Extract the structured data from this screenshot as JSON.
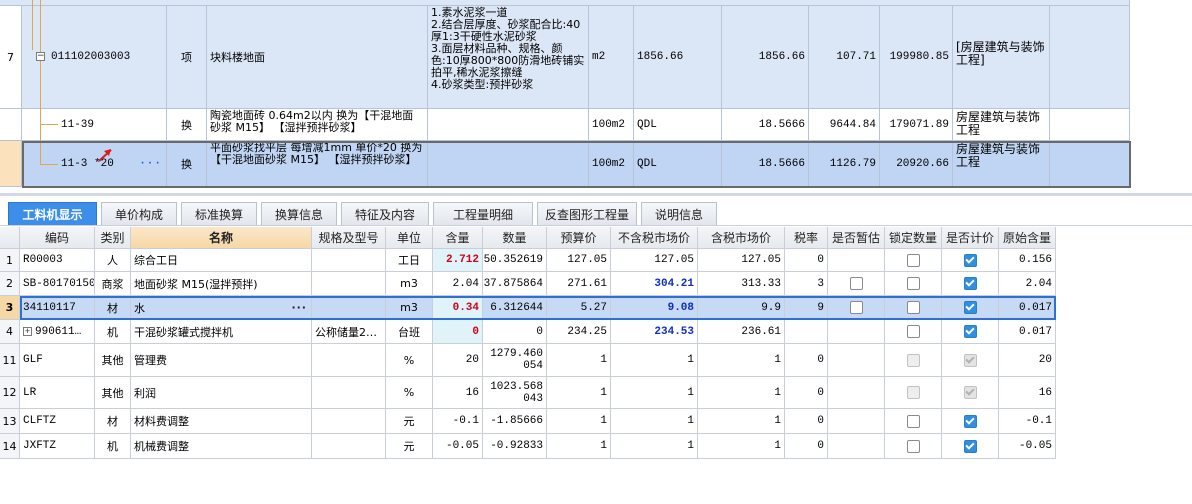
{
  "upper_grid": {
    "rows": [
      {
        "row_no": "7",
        "code": "011102003003",
        "type": "项",
        "name": "块料楼地面",
        "features": "1.素水泥浆一道\n2.结合层厚度、砂浆配合比:40厚1:3干硬性水泥砂浆\n3.面层材料品种、规格、颜色:10厚800*800防滑地砖铺实拍平,稀水泥浆擦缝\n4.砂浆类型:预拌砂浆",
        "unit": "m2",
        "expr": "1856.66",
        "qty": "1856.66",
        "price": "107.71",
        "total": "199980.85",
        "specialty": "[房屋建筑与装饰工程]"
      },
      {
        "row_no": "",
        "code": "11-39",
        "type": "换",
        "name": "陶瓷地面砖 0.64m2以内  换为【干混地面砂浆 M15】 【湿拌预拌砂浆】",
        "features": "",
        "unit": "100m2",
        "expr": "QDL",
        "qty": "18.5666",
        "price": "9644.84",
        "total": "179071.89",
        "specialty": "房屋建筑与装饰工程"
      },
      {
        "row_no": "",
        "code": "11-3 *20",
        "type": "换",
        "name": "平面砂浆找平层 每增减1mm  单价*20 换为【干混地面砂浆 M15】 【湿拌预拌砂浆】",
        "features": "",
        "unit": "100m2",
        "expr": "QDL",
        "qty": "18.5666",
        "price": "1126.79",
        "total": "20920.66",
        "specialty": "房屋建筑与装饰工程",
        "ellipsis": "···"
      }
    ]
  },
  "tabs": [
    {
      "label": "工料机显示",
      "active": true
    },
    {
      "label": "单价构成",
      "active": false
    },
    {
      "label": "标准换算",
      "active": false
    },
    {
      "label": "换算信息",
      "active": false
    },
    {
      "label": "特征及内容",
      "active": false
    },
    {
      "label": "工程量明细",
      "active": false
    },
    {
      "label": "反查图形工程量",
      "active": false
    },
    {
      "label": "说明信息",
      "active": false
    }
  ],
  "lower_grid": {
    "headers": [
      "编码",
      "类别",
      "名称",
      "规格及型号",
      "单位",
      "含量",
      "数量",
      "预算价",
      "不含税市场价",
      "含税市场价",
      "税率",
      "是否暂估",
      "锁定数量",
      "是否计价",
      "原始含量"
    ],
    "rows": [
      {
        "rn": "1",
        "code": "R00003",
        "cat": "人",
        "name": "综合工日",
        "spec": "",
        "unit": "工日",
        "content": "2.712",
        "qty": "50.352619",
        "budget": "127.05",
        "mkt_ex": "127.05",
        "mkt_in": "127.05",
        "tax": "0",
        "est": "",
        "lock": "off",
        "priced": "on",
        "orig": "0.156",
        "content_style": "red",
        "mkt_style": ""
      },
      {
        "rn": "2",
        "code": "SB-80170150",
        "cat": "商浆",
        "name": "地面砂浆 M15(湿拌预拌)",
        "spec": "",
        "unit": "m3",
        "content": "2.04",
        "qty": "37.875864",
        "budget": "271.61",
        "mkt_ex": "304.21",
        "mkt_in": "313.33",
        "tax": "3",
        "est": "off",
        "lock": "off",
        "priced": "on",
        "orig": "2.04",
        "content_style": "",
        "mkt_style": "blue"
      },
      {
        "rn": "3",
        "code": "34110117",
        "cat": "材",
        "name": "水",
        "spec": "",
        "unit": "m3",
        "content": "0.34",
        "qty": "6.312644",
        "budget": "5.27",
        "mkt_ex": "9.08",
        "mkt_in": "9.9",
        "tax": "9",
        "est": "off",
        "lock": "off",
        "priced": "on",
        "orig": "0.017",
        "content_style": "red",
        "mkt_style": "blue",
        "ellipsis": "···"
      },
      {
        "rn": "4",
        "code": "990611…",
        "cat": "机",
        "name": "干混砂浆罐式搅拌机",
        "spec": "公称储量2…",
        "unit": "台班",
        "content": "0",
        "qty": "0",
        "budget": "234.25",
        "mkt_ex": "234.53",
        "mkt_in": "236.61",
        "tax": "",
        "est": "",
        "lock": "off",
        "priced": "on",
        "orig": "0.017",
        "content_style": "red",
        "mkt_style": "blue",
        "expander": "+"
      },
      {
        "rn": "11",
        "code": "GLF",
        "cat": "其他",
        "name": "管理费",
        "spec": "",
        "unit": "%",
        "content": "20",
        "qty": "1279.460054",
        "budget": "1",
        "mkt_ex": "1",
        "mkt_in": "1",
        "tax": "0",
        "est": "",
        "lock": "dis",
        "priced": "dis",
        "orig": "20",
        "content_style": "",
        "mkt_style": ""
      },
      {
        "rn": "12",
        "code": "LR",
        "cat": "其他",
        "name": "利润",
        "spec": "",
        "unit": "%",
        "content": "16",
        "qty": "1023.568043",
        "budget": "1",
        "mkt_ex": "1",
        "mkt_in": "1",
        "tax": "0",
        "est": "",
        "lock": "dis",
        "priced": "dis",
        "orig": "16",
        "content_style": "",
        "mkt_style": ""
      },
      {
        "rn": "13",
        "code": "CLFTZ",
        "cat": "材",
        "name": "材料费调整",
        "spec": "",
        "unit": "元",
        "content": "-0.1",
        "qty": "-1.85666",
        "budget": "1",
        "mkt_ex": "1",
        "mkt_in": "1",
        "tax": "0",
        "est": "",
        "lock": "off",
        "priced": "on",
        "orig": "-0.1",
        "content_style": "",
        "mkt_style": ""
      },
      {
        "rn": "14",
        "code": "JXFTZ",
        "cat": "机",
        "name": "机械费调整",
        "spec": "",
        "unit": "元",
        "content": "-0.05",
        "qty": "-0.92833",
        "budget": "1",
        "mkt_ex": "1",
        "mkt_in": "1",
        "tax": "0",
        "est": "",
        "lock": "off",
        "priced": "on",
        "orig": "-0.05",
        "content_style": "",
        "mkt_style": ""
      }
    ]
  },
  "colors": {
    "row_blue": "#dbe6f7",
    "row_selected": "#bfd5f3",
    "tab_active": "#3d8ee8",
    "header_highlight": "#f6d8a6",
    "value_red": "#d0021b",
    "value_blue": "#0d2fbf",
    "checkbox_on": "#2f8fe0"
  }
}
